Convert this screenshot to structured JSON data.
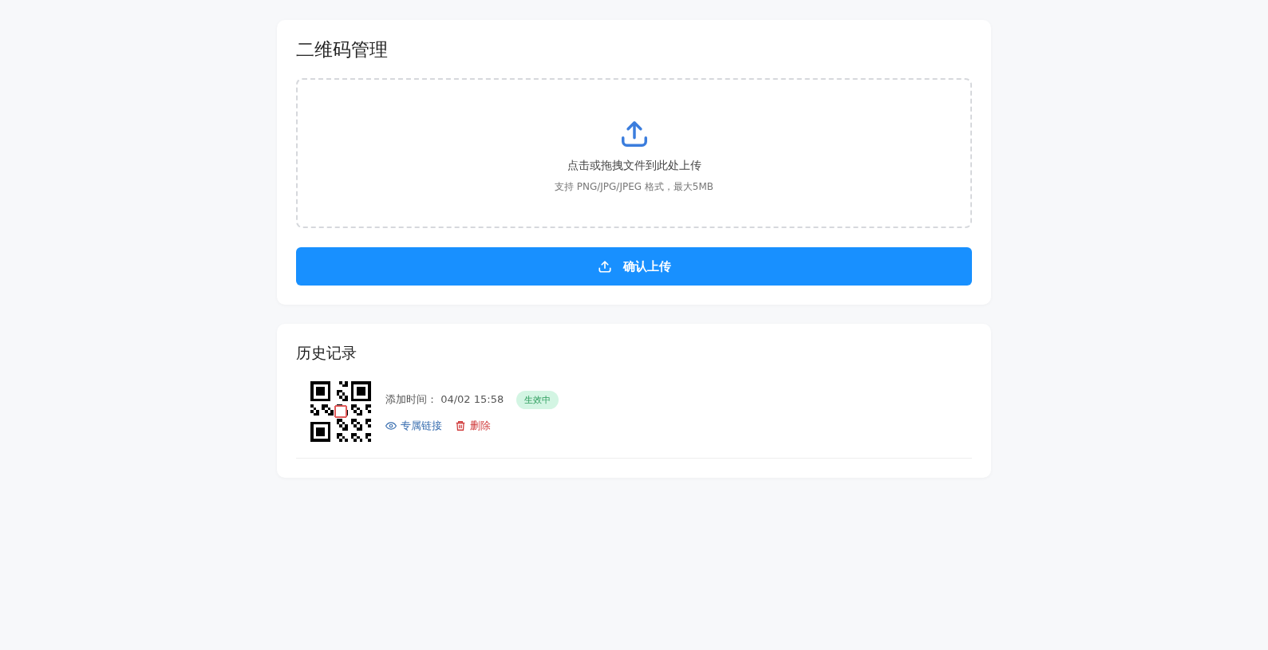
{
  "title": "二维码管理",
  "upload": {
    "prompt": "点击或拖拽文件到此处上传",
    "hint": "支持 PNG/JPG/JPEG 格式，最大5MB"
  },
  "confirm_button": "确认上传",
  "history": {
    "title": "历史记录",
    "records": [
      {
        "added_label": "添加时间：",
        "added_time": "04/02 15:58",
        "status": {
          "label": "生效中",
          "active": true
        },
        "link": "专属链接",
        "delete": "删除"
      }
    ]
  }
}
